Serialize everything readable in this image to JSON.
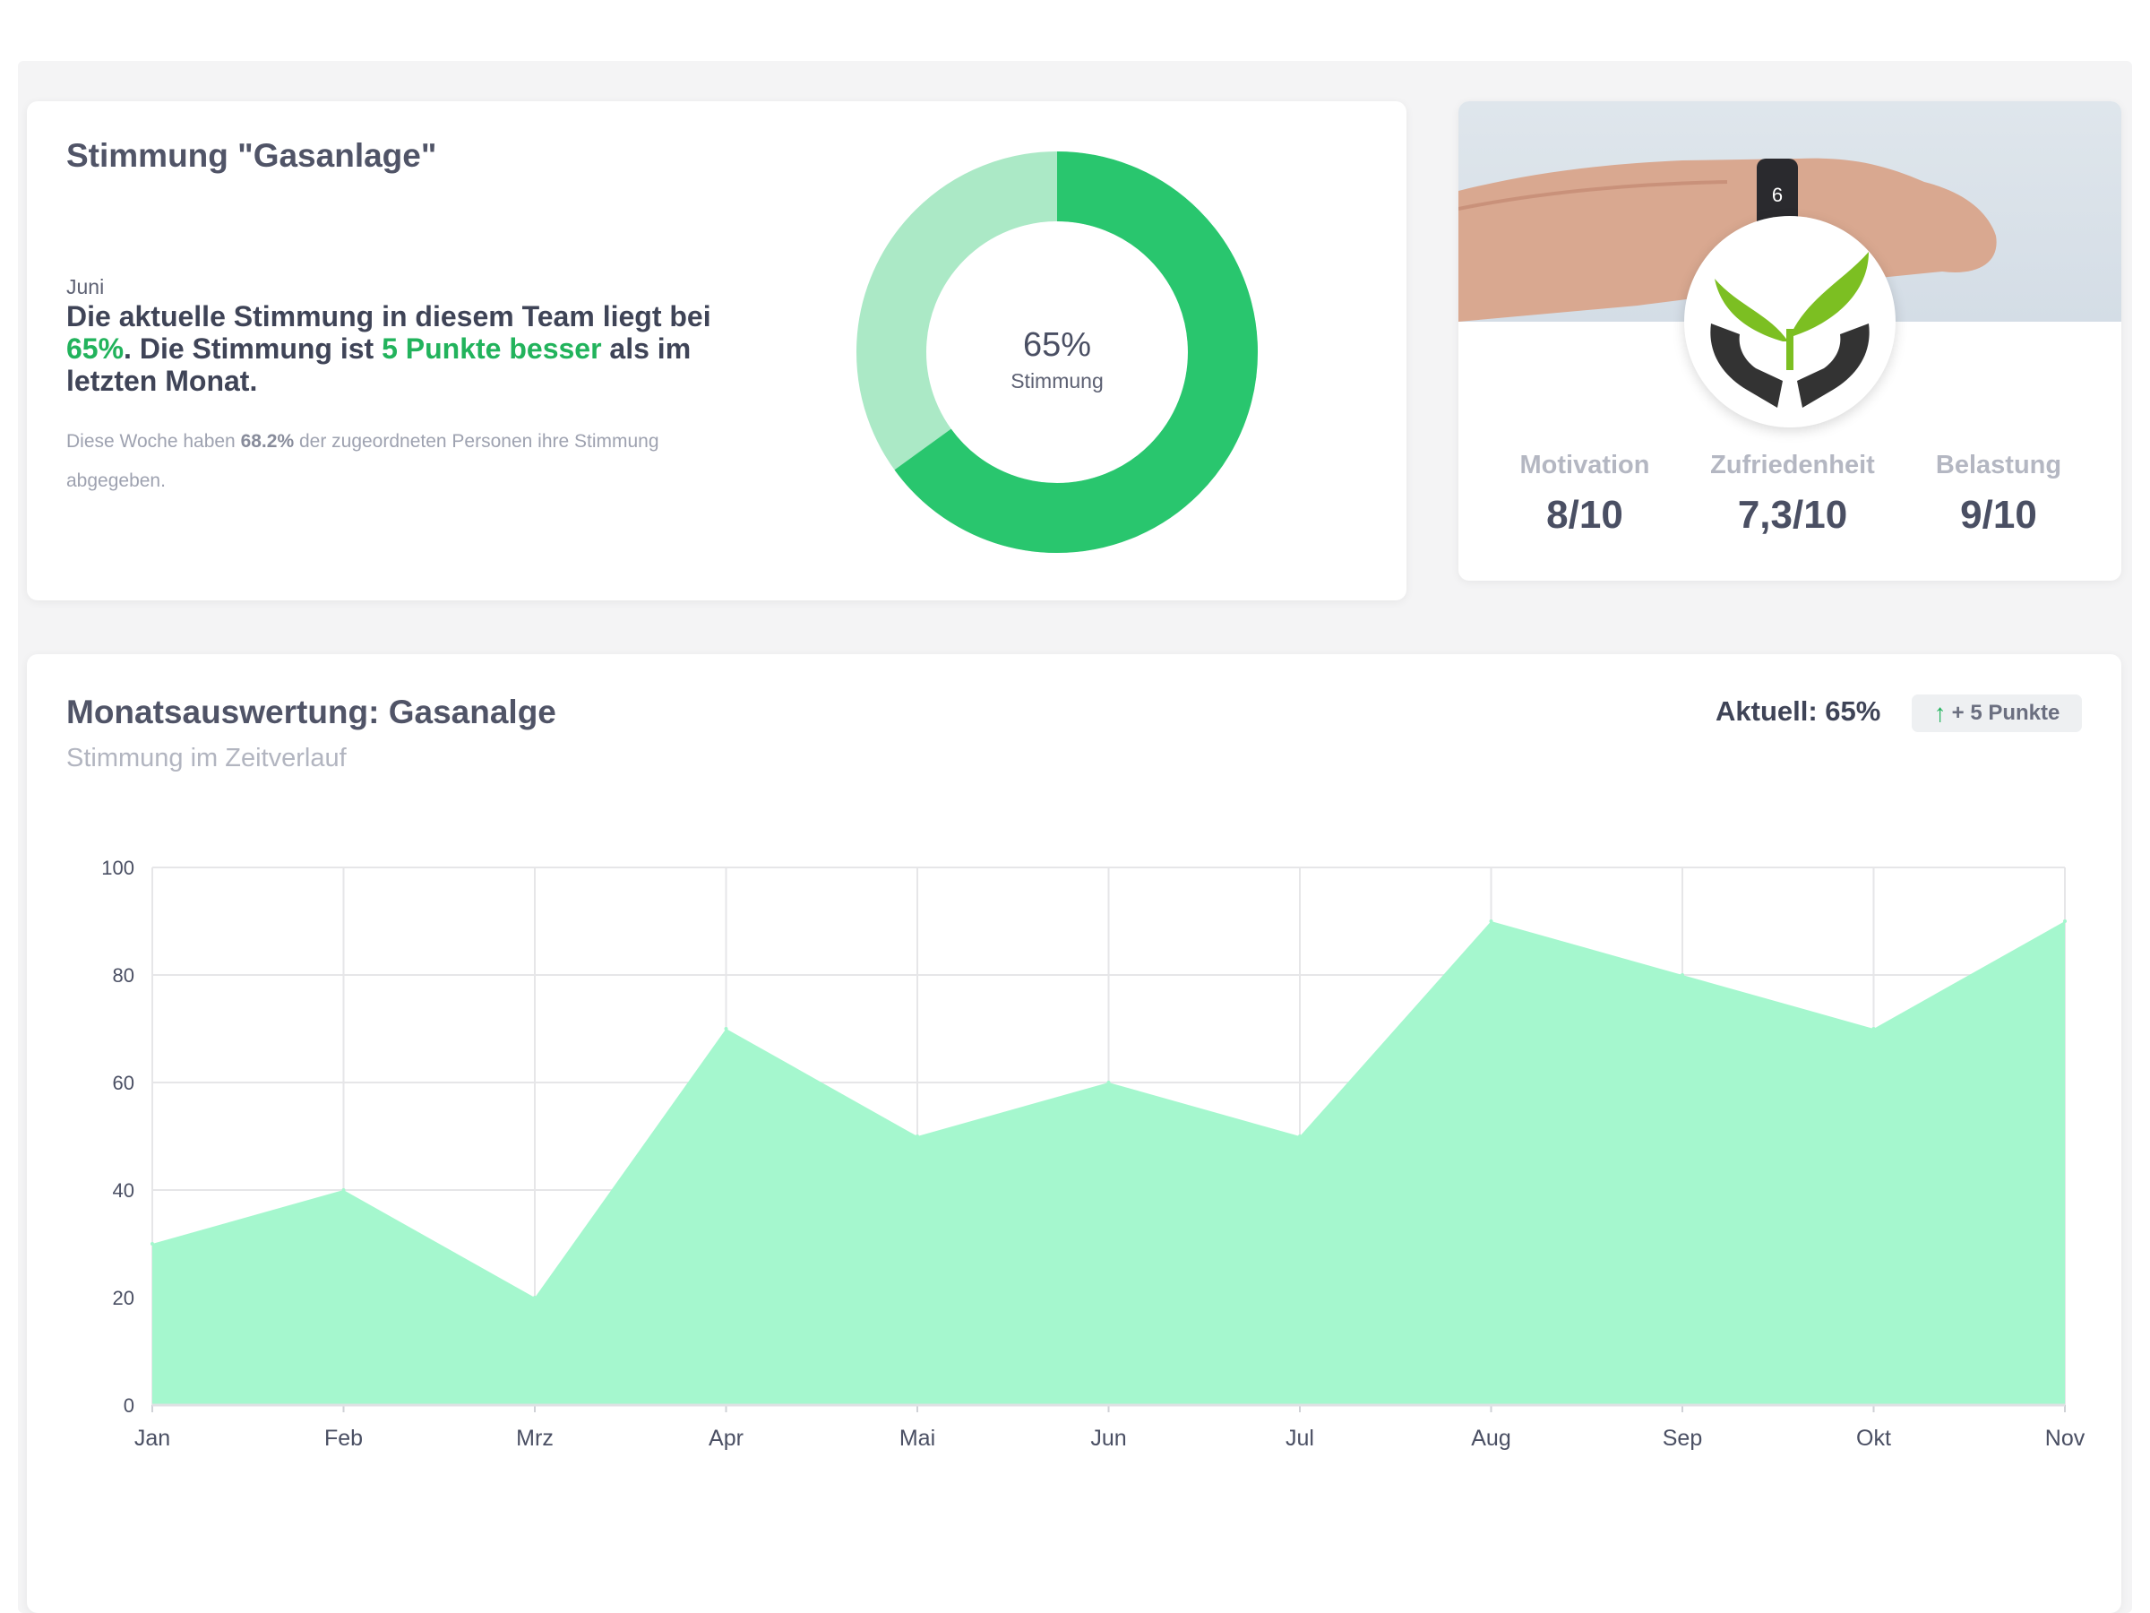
{
  "mood": {
    "title": "Stimmung \"Gasanlage\"",
    "month": "Juni",
    "summary": {
      "part1": "Die aktuelle Stimmung in diesem Team liegt bei ",
      "value": "65%",
      "part2": ". Die Stimmung ist ",
      "delta": "5 Punkte besser",
      "part3": " als im letzten Monat."
    },
    "note": {
      "part1": "Diese Woche haben ",
      "value": "68.2%",
      "part2": " der zugeordneten Personen ihre Stimmung abgegeben."
    },
    "donut": {
      "value_label": "65%",
      "caption": "Stimmung",
      "percent": 65,
      "color_fill": "#29c66e",
      "color_rest": "#abe9c6"
    }
  },
  "profile": {
    "photo_icon": "arm-with-smartwatch-photo",
    "badge_icon": "hands-with-plant-icon",
    "stats": [
      {
        "label": "Motivation",
        "value": "8/10"
      },
      {
        "label": "Zufriedenheit",
        "value": "7,3/10"
      },
      {
        "label": "Belastung",
        "value": "9/10"
      }
    ]
  },
  "monthly": {
    "title": "Monatsauswertung: Gasanalge",
    "subtitle": "Stimmung im Zeitverlauf",
    "current_label": "Aktuell: 65%",
    "delta_badge": "+ 5 Punkte",
    "delta_icon": "arrow-up-icon"
  },
  "chart_data": {
    "type": "area",
    "categories": [
      "Jan",
      "Feb",
      "Mrz",
      "Apr",
      "Mai",
      "Jun",
      "Jul",
      "Aug",
      "Sep",
      "Okt",
      "Nov"
    ],
    "values": [
      30,
      40,
      20,
      70,
      50,
      60,
      50,
      90,
      80,
      70,
      90
    ],
    "yticks": [
      0,
      20,
      40,
      60,
      80,
      100
    ],
    "ylim": [
      0,
      100
    ],
    "grid": true,
    "fill_color": "#a5f7ce",
    "title": "",
    "xlabel": "",
    "ylabel": ""
  }
}
